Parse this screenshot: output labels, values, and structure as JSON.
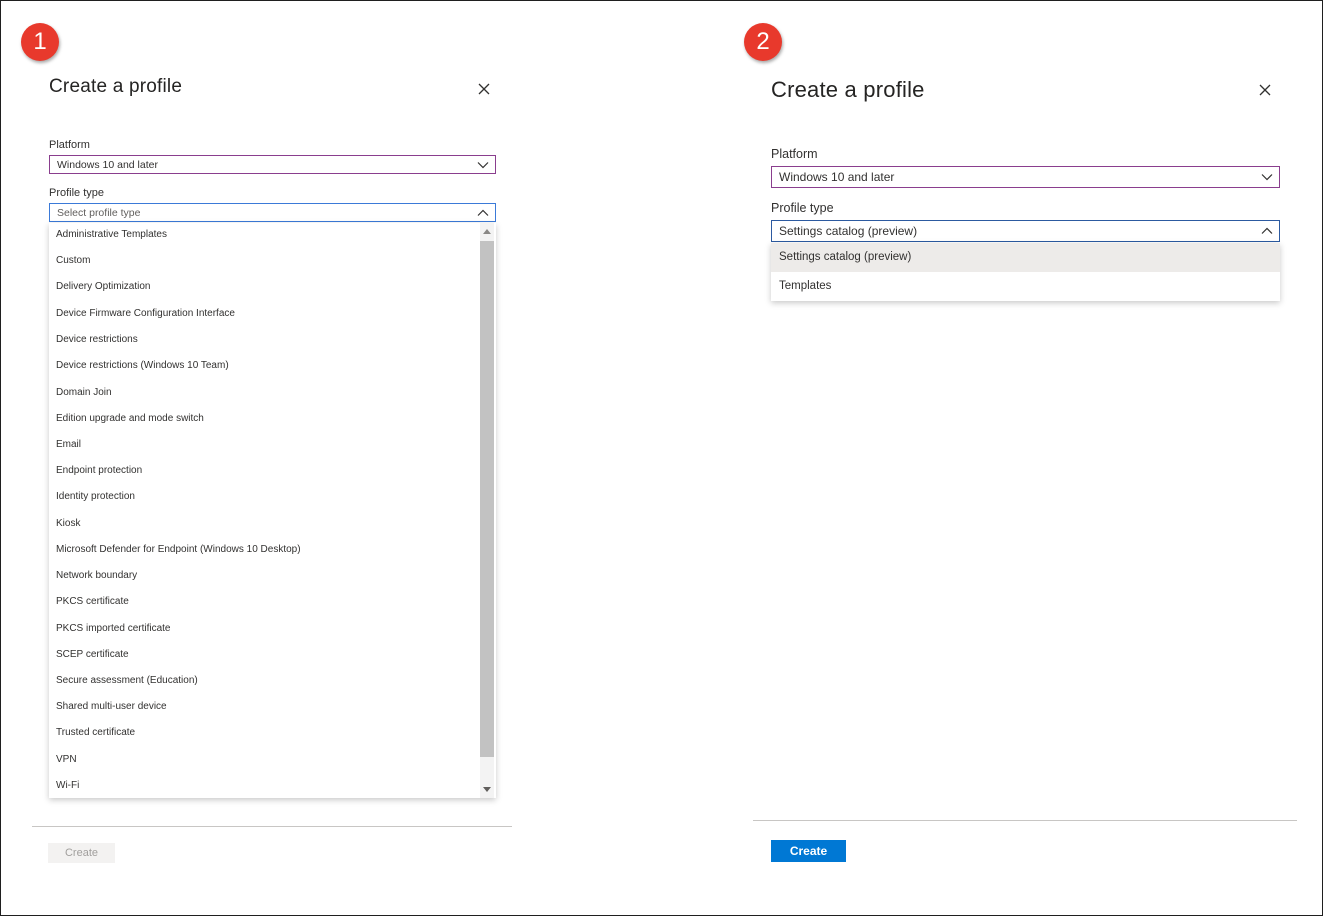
{
  "panel1": {
    "step": "1",
    "title": "Create a profile",
    "platform_label": "Platform",
    "platform_value": "Windows 10 and later",
    "profile_type_label": "Profile type",
    "profile_type_placeholder": "Select profile type",
    "options": [
      "Administrative Templates",
      "Custom",
      "Delivery Optimization",
      "Device Firmware Configuration Interface",
      "Device restrictions",
      "Device restrictions (Windows 10 Team)",
      "Domain Join",
      "Edition upgrade and mode switch",
      "Email",
      "Endpoint protection",
      "Identity protection",
      "Kiosk",
      "Microsoft Defender for Endpoint (Windows 10 Desktop)",
      "Network boundary",
      "PKCS certificate",
      "PKCS imported certificate",
      "SCEP certificate",
      "Secure assessment (Education)",
      "Shared multi-user device",
      "Trusted certificate",
      "VPN",
      "Wi-Fi"
    ],
    "create_label": "Create"
  },
  "panel2": {
    "step": "2",
    "title": "Create a profile",
    "platform_label": "Platform",
    "platform_value": "Windows 10 and later",
    "profile_type_label": "Profile type",
    "profile_type_value": "Settings catalog (preview)",
    "options": [
      "Settings catalog (preview)",
      "Templates"
    ],
    "create_label": "Create"
  },
  "colors": {
    "badge": "#e8392c",
    "accent": "#0078d4",
    "select_border": "#8a3e8e",
    "focus_border": "#3b7ad8"
  }
}
